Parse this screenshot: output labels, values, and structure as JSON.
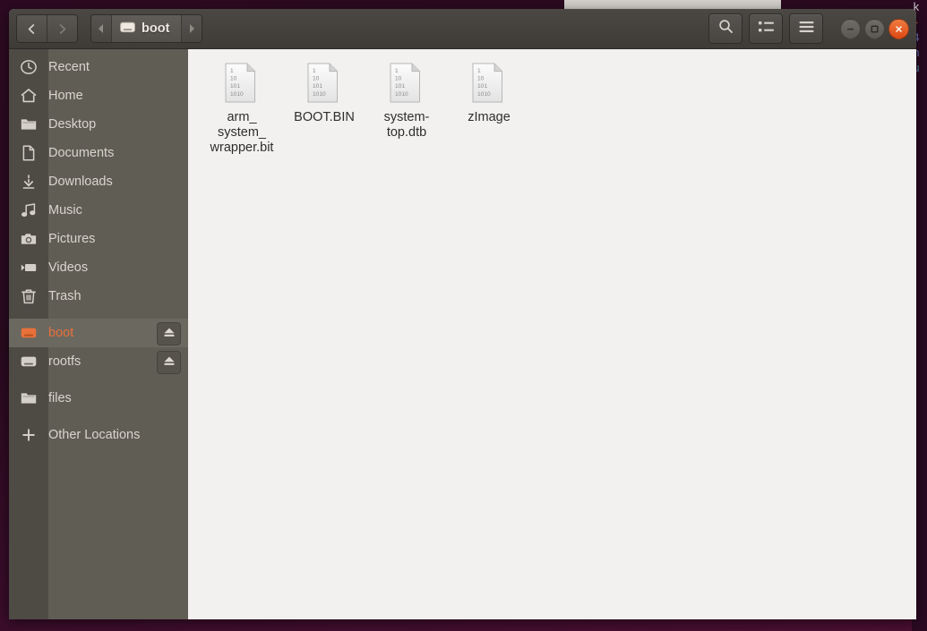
{
  "window": {
    "title": "boot",
    "nav": {
      "back_label": "Back",
      "forward_label": "Forward"
    },
    "pathbar": {
      "prev_label": "◂",
      "next_label": "▸",
      "crumb_label": "boot",
      "crumb_icon": "drive-harddisk-icon"
    },
    "tools": {
      "search_label": "Search",
      "view_label": "View options",
      "menu_label": "Menu"
    },
    "controls": {
      "minimize_label": "Minimize",
      "maximize_label": "Maximize",
      "close_label": "Close"
    }
  },
  "sidebar": {
    "items": [
      {
        "label": "Recent",
        "icon": "clock-icon",
        "selected": false,
        "eject": false,
        "spaced": false
      },
      {
        "label": "Home",
        "icon": "home-icon",
        "selected": false,
        "eject": false,
        "spaced": false
      },
      {
        "label": "Desktop",
        "icon": "folder-icon",
        "selected": false,
        "eject": false,
        "spaced": false
      },
      {
        "label": "Documents",
        "icon": "document-icon",
        "selected": false,
        "eject": false,
        "spaced": false
      },
      {
        "label": "Downloads",
        "icon": "download-icon",
        "selected": false,
        "eject": false,
        "spaced": false
      },
      {
        "label": "Music",
        "icon": "music-icon",
        "selected": false,
        "eject": false,
        "spaced": false
      },
      {
        "label": "Pictures",
        "icon": "camera-icon",
        "selected": false,
        "eject": false,
        "spaced": false
      },
      {
        "label": "Videos",
        "icon": "video-icon",
        "selected": false,
        "eject": false,
        "spaced": false
      },
      {
        "label": "Trash",
        "icon": "trash-icon",
        "selected": false,
        "eject": false,
        "spaced": false
      },
      {
        "label": "boot",
        "icon": "drive-orange-icon",
        "selected": true,
        "eject": true,
        "spaced": true
      },
      {
        "label": "rootfs",
        "icon": "drive-icon",
        "selected": false,
        "eject": true,
        "spaced": false
      },
      {
        "label": "files",
        "icon": "folder-icon",
        "selected": false,
        "eject": false,
        "spaced": true
      },
      {
        "label": "Other Locations",
        "icon": "plus-icon",
        "selected": false,
        "eject": false,
        "spaced": true
      }
    ],
    "eject_label": "Eject"
  },
  "files": [
    {
      "name": "arm_\nsystem_\nwrapper.bit",
      "icon": "binary-file-icon",
      "binary_lines": [
        "1",
        "10",
        "101",
        "1010"
      ]
    },
    {
      "name": "BOOT.BIN",
      "icon": "binary-file-icon",
      "binary_lines": [
        "1",
        "10",
        "101",
        "1010"
      ]
    },
    {
      "name": "system-\ntop.dtb",
      "icon": "binary-file-icon",
      "binary_lines": [
        "1",
        "10",
        "101",
        "1010"
      ]
    },
    {
      "name": "zImage",
      "icon": "binary-file-icon",
      "binary_lines": [
        "1",
        "10",
        "101",
        "1010"
      ]
    }
  ],
  "background": {
    "terminal_lines": [
      {
        "text": "k",
        "color": "white"
      },
      {
        "text": "-",
        "color": "orange"
      },
      {
        "text": "",
        "color": "white"
      },
      {
        "text": "4",
        "color": "blue"
      },
      {
        "text": "",
        "color": "white"
      },
      {
        "text": "",
        "color": "white"
      },
      {
        "text": "",
        "color": "white"
      },
      {
        "text": "n",
        "color": "blue"
      },
      {
        "text": "",
        "color": "white"
      },
      {
        "text": "u",
        "color": "cyan"
      }
    ]
  },
  "colors": {
    "accent": "#dd4814",
    "headerbar": "#484540",
    "sidebar": "#605d55",
    "content": "#f2f1ef",
    "selected_text": "#e8703a"
  }
}
